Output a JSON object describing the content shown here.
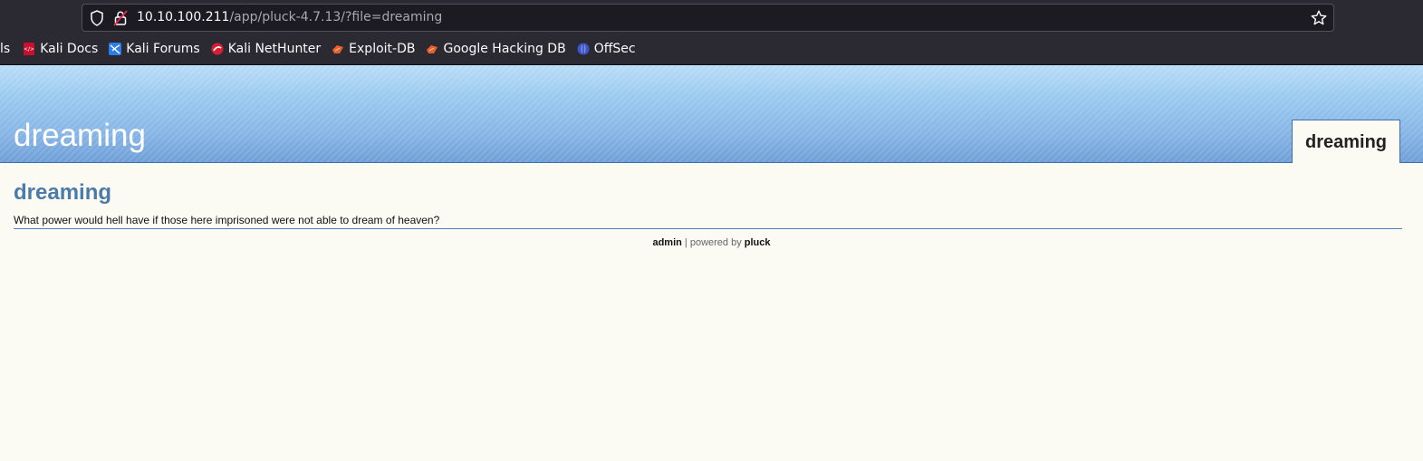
{
  "browser": {
    "url_host": "10.10.100.211",
    "url_path": "/app/pluck-4.7.13/?file=dreaming",
    "bookmarks": [
      {
        "label": "ls",
        "icon": "cut-off-bookmark"
      },
      {
        "label": "Kali Docs",
        "icon": "kali-docs-icon"
      },
      {
        "label": "Kali Forums",
        "icon": "kali-forums-icon"
      },
      {
        "label": "Kali NetHunter",
        "icon": "kali-nethunter-icon"
      },
      {
        "label": "Exploit-DB",
        "icon": "exploit-db-icon"
      },
      {
        "label": "Google Hacking DB",
        "icon": "ghdb-icon"
      },
      {
        "label": "OffSec",
        "icon": "offsec-icon"
      }
    ]
  },
  "site": {
    "title": "dreaming",
    "nav_tab": "dreaming"
  },
  "page": {
    "heading": "dreaming",
    "text": "What power would hell have if those here imprisoned were not able to dream of heaven?"
  },
  "footer": {
    "admin_link": "admin",
    "separator": " | powered by ",
    "pluck_link": "pluck"
  },
  "colors": {
    "chrome_bg": "#2b2a33",
    "header_blue": "#87b5e6",
    "heading_blue": "#4b7bab",
    "page_bg": "#fbfbf3"
  }
}
